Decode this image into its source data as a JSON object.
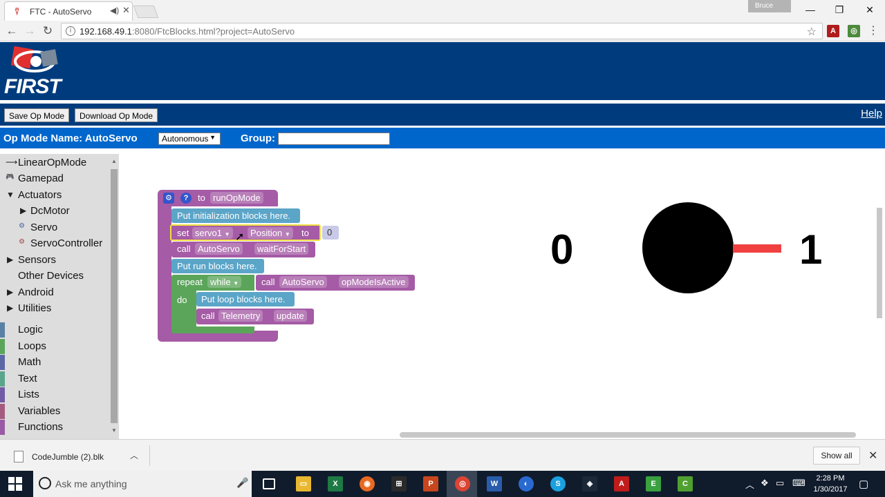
{
  "browser": {
    "tab_title": "FTC - AutoServo",
    "tab_close": "✕",
    "profile_name": "Bruce",
    "url_host": "192.168.49.1",
    "url_path": ":8080/FtcBlocks.html?project=AutoServo"
  },
  "page": {
    "logo_text": "FIRST",
    "buttons": {
      "save": "Save Op Mode",
      "download": "Download Op Mode"
    },
    "help": "Help",
    "opmode_label": "Op Mode Name: AutoServo",
    "opmode_type": "Autonomous",
    "group_label": "Group:",
    "group_value": ""
  },
  "toolbox": {
    "items": [
      {
        "label": "LinearOpMode",
        "glyph": "⟶"
      },
      {
        "label": "Gamepad",
        "glyph": "🎮"
      },
      {
        "label": "Actuators",
        "glyph": "▼"
      },
      {
        "label": "DcMotor",
        "glyph": "▶"
      },
      {
        "label": "Servo",
        "glyph": "⚙"
      },
      {
        "label": "ServoController",
        "glyph": "⚙"
      },
      {
        "label": "Sensors",
        "glyph": "▶"
      },
      {
        "label": "Other Devices",
        "glyph": ""
      },
      {
        "label": "Android",
        "glyph": "▶"
      },
      {
        "label": "Utilities",
        "glyph": "▶"
      }
    ],
    "categories": [
      {
        "label": "Logic",
        "color": "#5b80a5"
      },
      {
        "label": "Loops",
        "color": "#5ba55b"
      },
      {
        "label": "Math",
        "color": "#5b67a5"
      },
      {
        "label": "Text",
        "color": "#5ba58c"
      },
      {
        "label": "Lists",
        "color": "#745ba5"
      },
      {
        "label": "Variables",
        "color": "#a55b80"
      },
      {
        "label": "Functions",
        "color": "#995ba5"
      }
    ]
  },
  "blocks": {
    "header_to": "to",
    "header_name": "runOpMode",
    "comment_init": "Put initialization blocks here.",
    "set_kw": "set",
    "servo": "servo1",
    "prop": "Position",
    "to_kw": "to",
    "value": "0",
    "call_kw": "call",
    "autoservo": "AutoServo",
    "wait": "waitForStart",
    "comment_run": "Put run blocks here.",
    "repeat_kw": "repeat",
    "while_kw": "while",
    "active": "opModeIsActive",
    "do_kw": "do",
    "comment_loop": "Put loop blocks here.",
    "telemetry": "Telemetry",
    "update": "update"
  },
  "servo_display": {
    "left_value": "0",
    "right_value": "1",
    "arm_color": "#f04040"
  },
  "downloads": {
    "file_name": "CodeJumble (2).blk",
    "show_all": "Show all"
  },
  "taskbar": {
    "search_placeholder": "Ask me anything",
    "time": "2:28 PM",
    "date": "1/30/2017"
  }
}
